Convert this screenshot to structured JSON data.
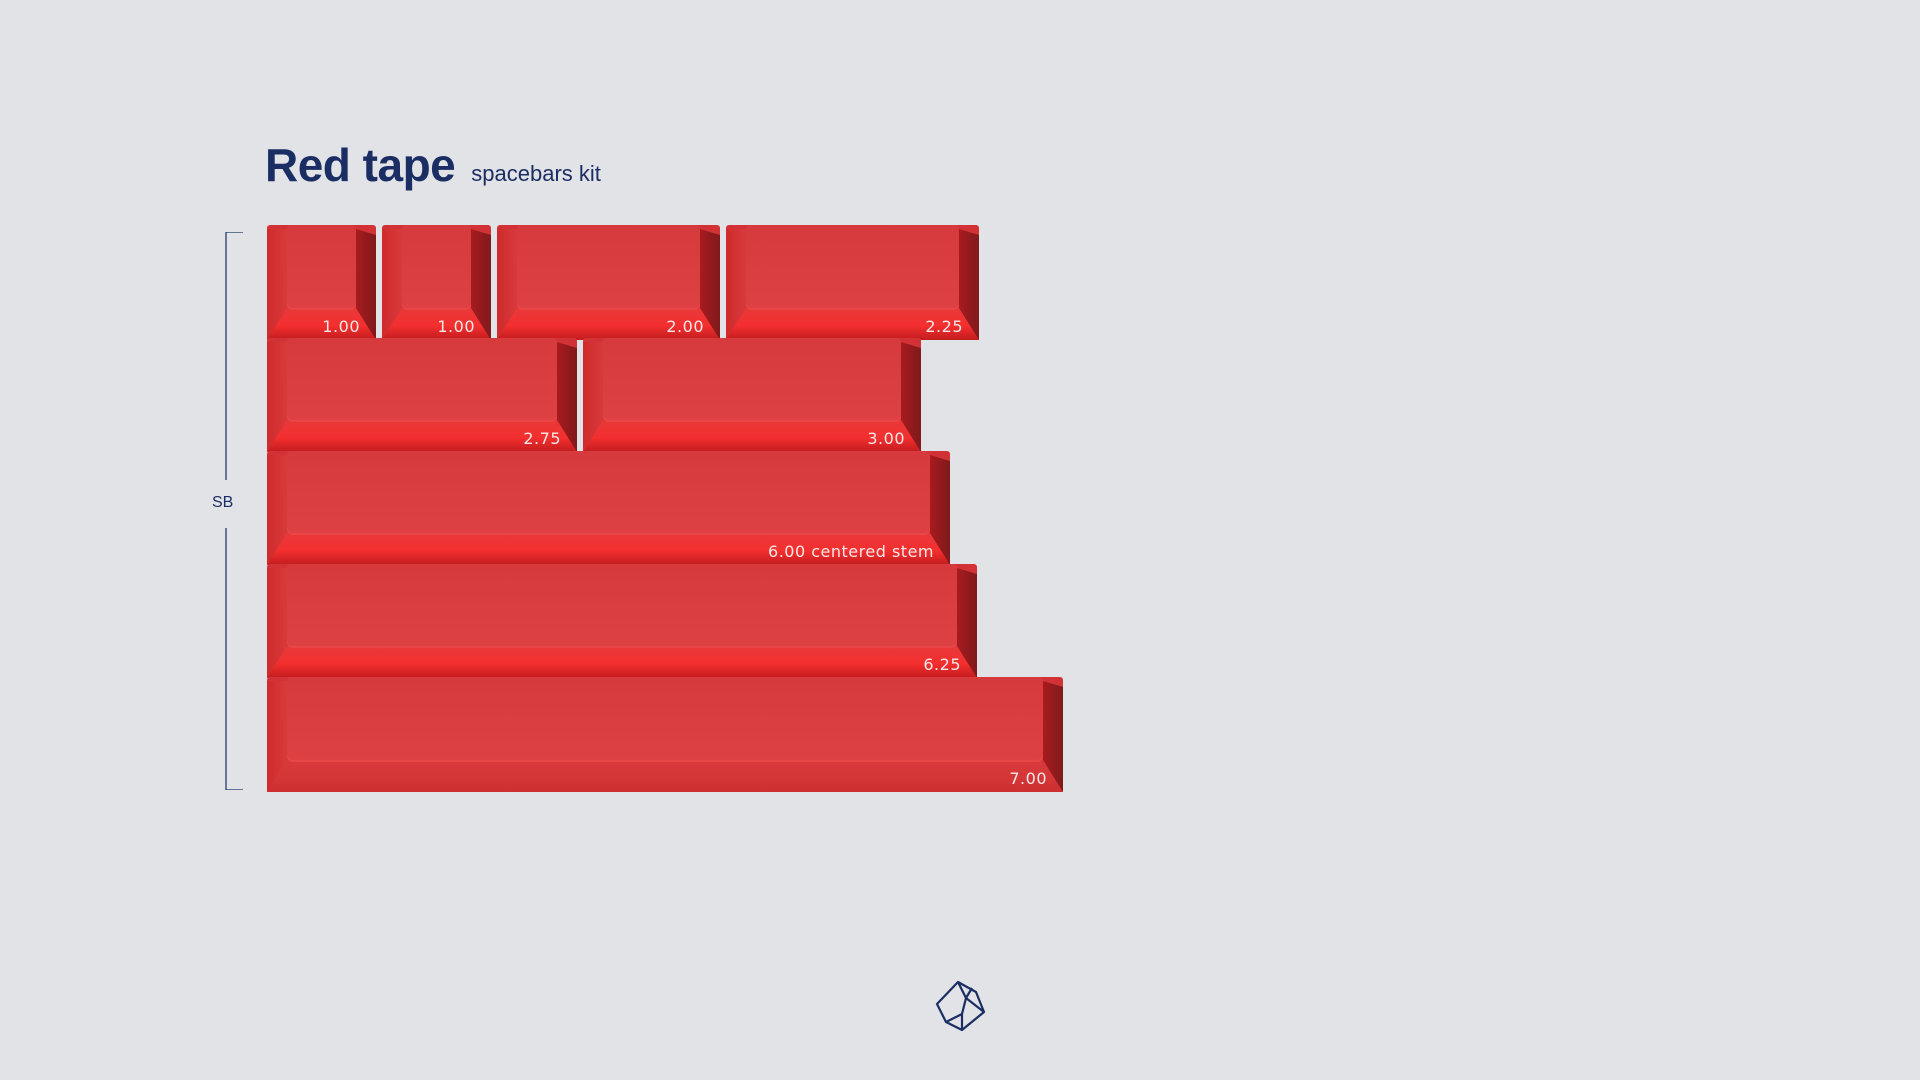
{
  "header": {
    "title": "Red tape",
    "subtitle": "spacebars kit"
  },
  "bracket": {
    "label": "SB"
  },
  "keys": [
    {
      "label": "1.00"
    },
    {
      "label": "1.00"
    },
    {
      "label": "2.00"
    },
    {
      "label": "2.25"
    },
    {
      "label": "2.75"
    },
    {
      "label": "3.00"
    },
    {
      "label": "6.00 centered stem"
    },
    {
      "label": "6.25"
    },
    {
      "label": "7.00"
    }
  ],
  "colors": {
    "background": "#e1e3e7",
    "keycap": "#d63a3c",
    "text_accent": "#1b2e63"
  },
  "icons": {
    "brand_logo": "brand-logo-icon"
  }
}
